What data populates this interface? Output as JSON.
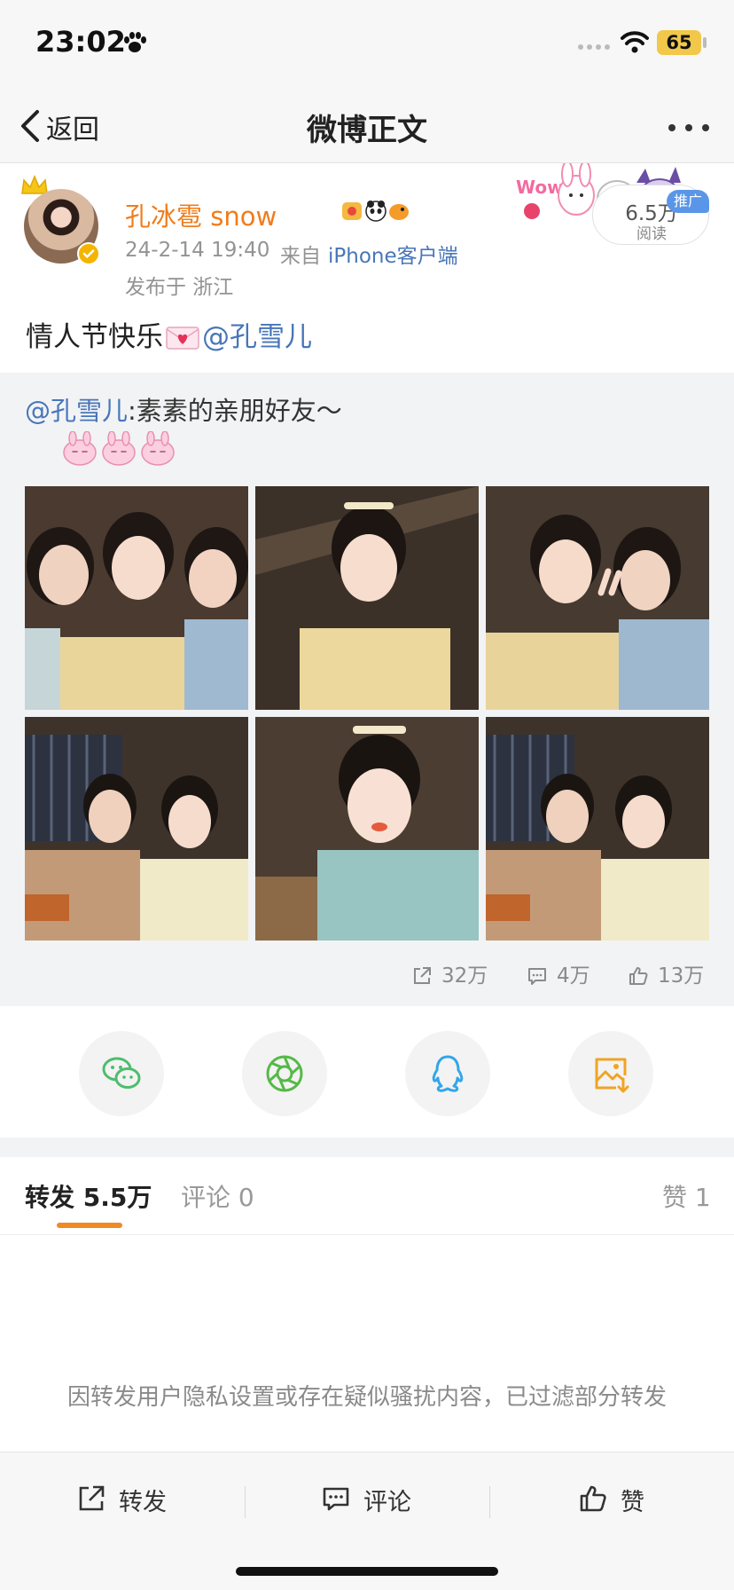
{
  "status_bar": {
    "time": "23:02",
    "battery": "65"
  },
  "nav": {
    "back_label": "返回",
    "title": "微博正文"
  },
  "post": {
    "username": "孔冰雹 snow",
    "time": "24-2-14 19:40",
    "source_label": "来自",
    "source": "iPhone客户端",
    "location": "发布于 浙江",
    "text": "情人节快乐",
    "mention": "@孔雪儿"
  },
  "ad": {
    "views": "6.5万",
    "views_label": "阅读",
    "tag": "推广"
  },
  "repost": {
    "mention": "@孔雪儿",
    "text": ":素素的亲朋好友～",
    "stats": {
      "reposts": "32万",
      "comments": "4万",
      "likes": "13万"
    }
  },
  "share_targets": [
    {
      "icon": "wechat-icon",
      "color": "#4dbd6e"
    },
    {
      "icon": "moments-icon",
      "color": "#55b947"
    },
    {
      "icon": "qq-icon",
      "color": "#33a6e8"
    },
    {
      "icon": "save-image-icon",
      "color": "#f0a424"
    }
  ],
  "tabs": {
    "reposts": "转发 5.5万",
    "comments": "评论 0",
    "likes": "赞 1"
  },
  "filter_note": "因转发用户隐私设置或存在疑似骚扰内容，已过滤部分转发",
  "toolbar": {
    "repost": "转发",
    "comment": "评论",
    "like": "赞"
  },
  "colors": {
    "accent": "#f08a24",
    "link": "#4876b8",
    "username": "#f07c1b"
  }
}
